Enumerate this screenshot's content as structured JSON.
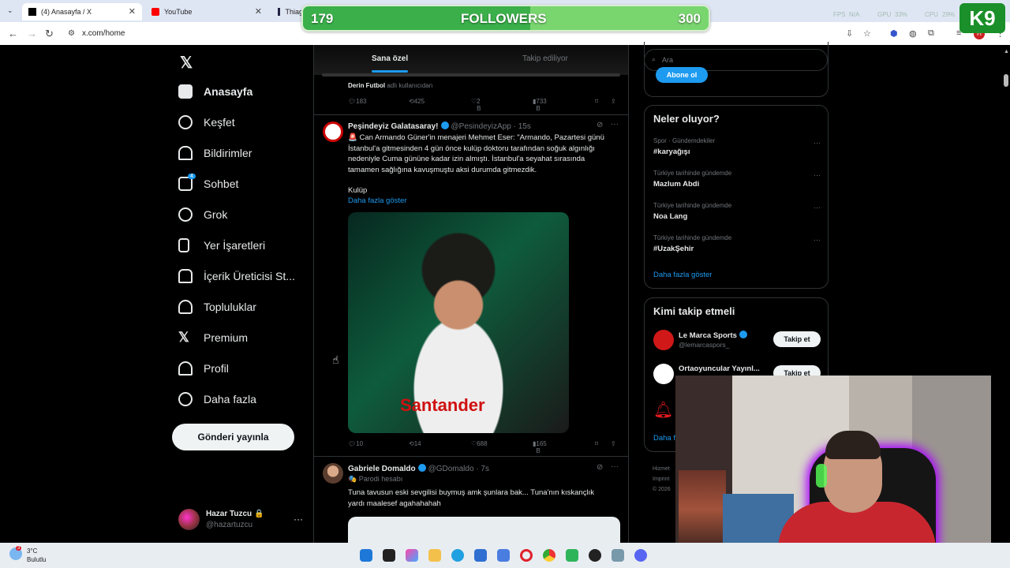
{
  "browser": {
    "tabs": [
      {
        "title": "(4) Anasayfa / X",
        "active": true
      },
      {
        "title": "YouTube",
        "active": false
      },
      {
        "title": "Thiag",
        "active": false
      }
    ],
    "url": "x.com/home"
  },
  "overlay": {
    "followers_label": "FOLLOWERS",
    "followers_current": "179",
    "followers_goal": "300",
    "followers_progress": 0.597,
    "fps_label": "FPS",
    "fps_value": "N/A",
    "gpu_label": "GPU",
    "gpu_value": "33%",
    "cpu_label": "CPU",
    "cpu_value": "29%",
    "logo_text": "K",
    "logo_number": "9"
  },
  "sidebar": {
    "items": [
      {
        "label": "Anasayfa",
        "icon": "home-icon"
      },
      {
        "label": "Keşfet",
        "icon": "search-icon"
      },
      {
        "label": "Bildirimler",
        "icon": "bell-icon"
      },
      {
        "label": "Sohbet",
        "icon": "mail-icon",
        "badge": "4"
      },
      {
        "label": "Grok",
        "icon": "grok-icon"
      },
      {
        "label": "Yer İşaretleri",
        "icon": "bookmark-icon"
      },
      {
        "label": "İçerik Üreticisi St...",
        "icon": "creator-icon"
      },
      {
        "label": "Topluluklar",
        "icon": "communities-icon"
      },
      {
        "label": "Premium",
        "icon": "x-icon"
      },
      {
        "label": "Profil",
        "icon": "person-icon"
      },
      {
        "label": "Daha fazla",
        "icon": "more-circle-icon"
      }
    ],
    "post_button": "Gönderi yayınla",
    "profile": {
      "name": "Hazar Tuzcu 🔒",
      "handle": "@hazartuzcu",
      "more": "···"
    }
  },
  "feed": {
    "tabs": [
      "Sana özel",
      "Takip ediliyor"
    ],
    "prev_tweet": {
      "context_name": "Derin Futbol",
      "context_suffix": "adlı kullanıcıdan",
      "replies": "183",
      "retweets": "425",
      "likes": "2 B",
      "views": "733 B"
    },
    "tweet1": {
      "name": "Peşindeyiz Galatasaray!",
      "handle": "@PesindeyizApp · 15s",
      "text": "🚨 Can Armando Güner'in menajeri Mehmet Eser: \"Armando, Pazartesi günü İstanbul'a gitmesinden 4 gün önce kulüp doktoru tarafından soğuk algınlığı nedeniyle Cuma gününe kadar izin almıştı. İstanbul'a seyahat sırasında tamamen sağlığına kavuşmuştu aksi durumda gitmezdik.",
      "text2": "Kulüp",
      "show_more": "Daha fazla göster",
      "image_text": "Santander",
      "replies": "10",
      "retweets": "14",
      "likes": "688",
      "views": "165 B"
    },
    "tweet2": {
      "name": "Gabriele Domaldo",
      "handle": "@GDomaldo · 7s",
      "parody": "🎭 Parodi hesabı",
      "text": "Tuna tavusun eski sevgilisi buymuş amk şunlara bak... Tuna'nın kıskançlık yardı maalesef agahahahah"
    }
  },
  "right": {
    "search_placeholder": "Ara",
    "subscribe": "Abone ol",
    "trends_title": "Neler oluyor?",
    "trends": [
      {
        "context": "Spor · Gündemdekiler",
        "name": "#karyağışı"
      },
      {
        "context": "Türkiye tarihinde gündemde",
        "name": "Mazlum Abdi"
      },
      {
        "context": "Türkiye tarihinde gündemde",
        "name": "Noa Lang"
      },
      {
        "context": "Türkiye tarihinde gündemde",
        "name": "#UzakŞehir"
      }
    ],
    "trends_more": "Daha fazla göster",
    "follow_title": "Kimi takip etmeli",
    "follow": [
      {
        "name": "Le Marca Sports",
        "handle": "@lemarcaspors_",
        "button": "Takip et"
      },
      {
        "name": "Ortaoyuncular Yayınl...",
        "handle": "",
        "button": "Takip et"
      }
    ],
    "follow_more": "Daha f",
    "footer": [
      "Hizmet",
      "Imprint",
      "© 2026"
    ]
  },
  "taskbar": {
    "temp": "3°C",
    "weather": "Bulutlu",
    "weather_badge": "3"
  }
}
